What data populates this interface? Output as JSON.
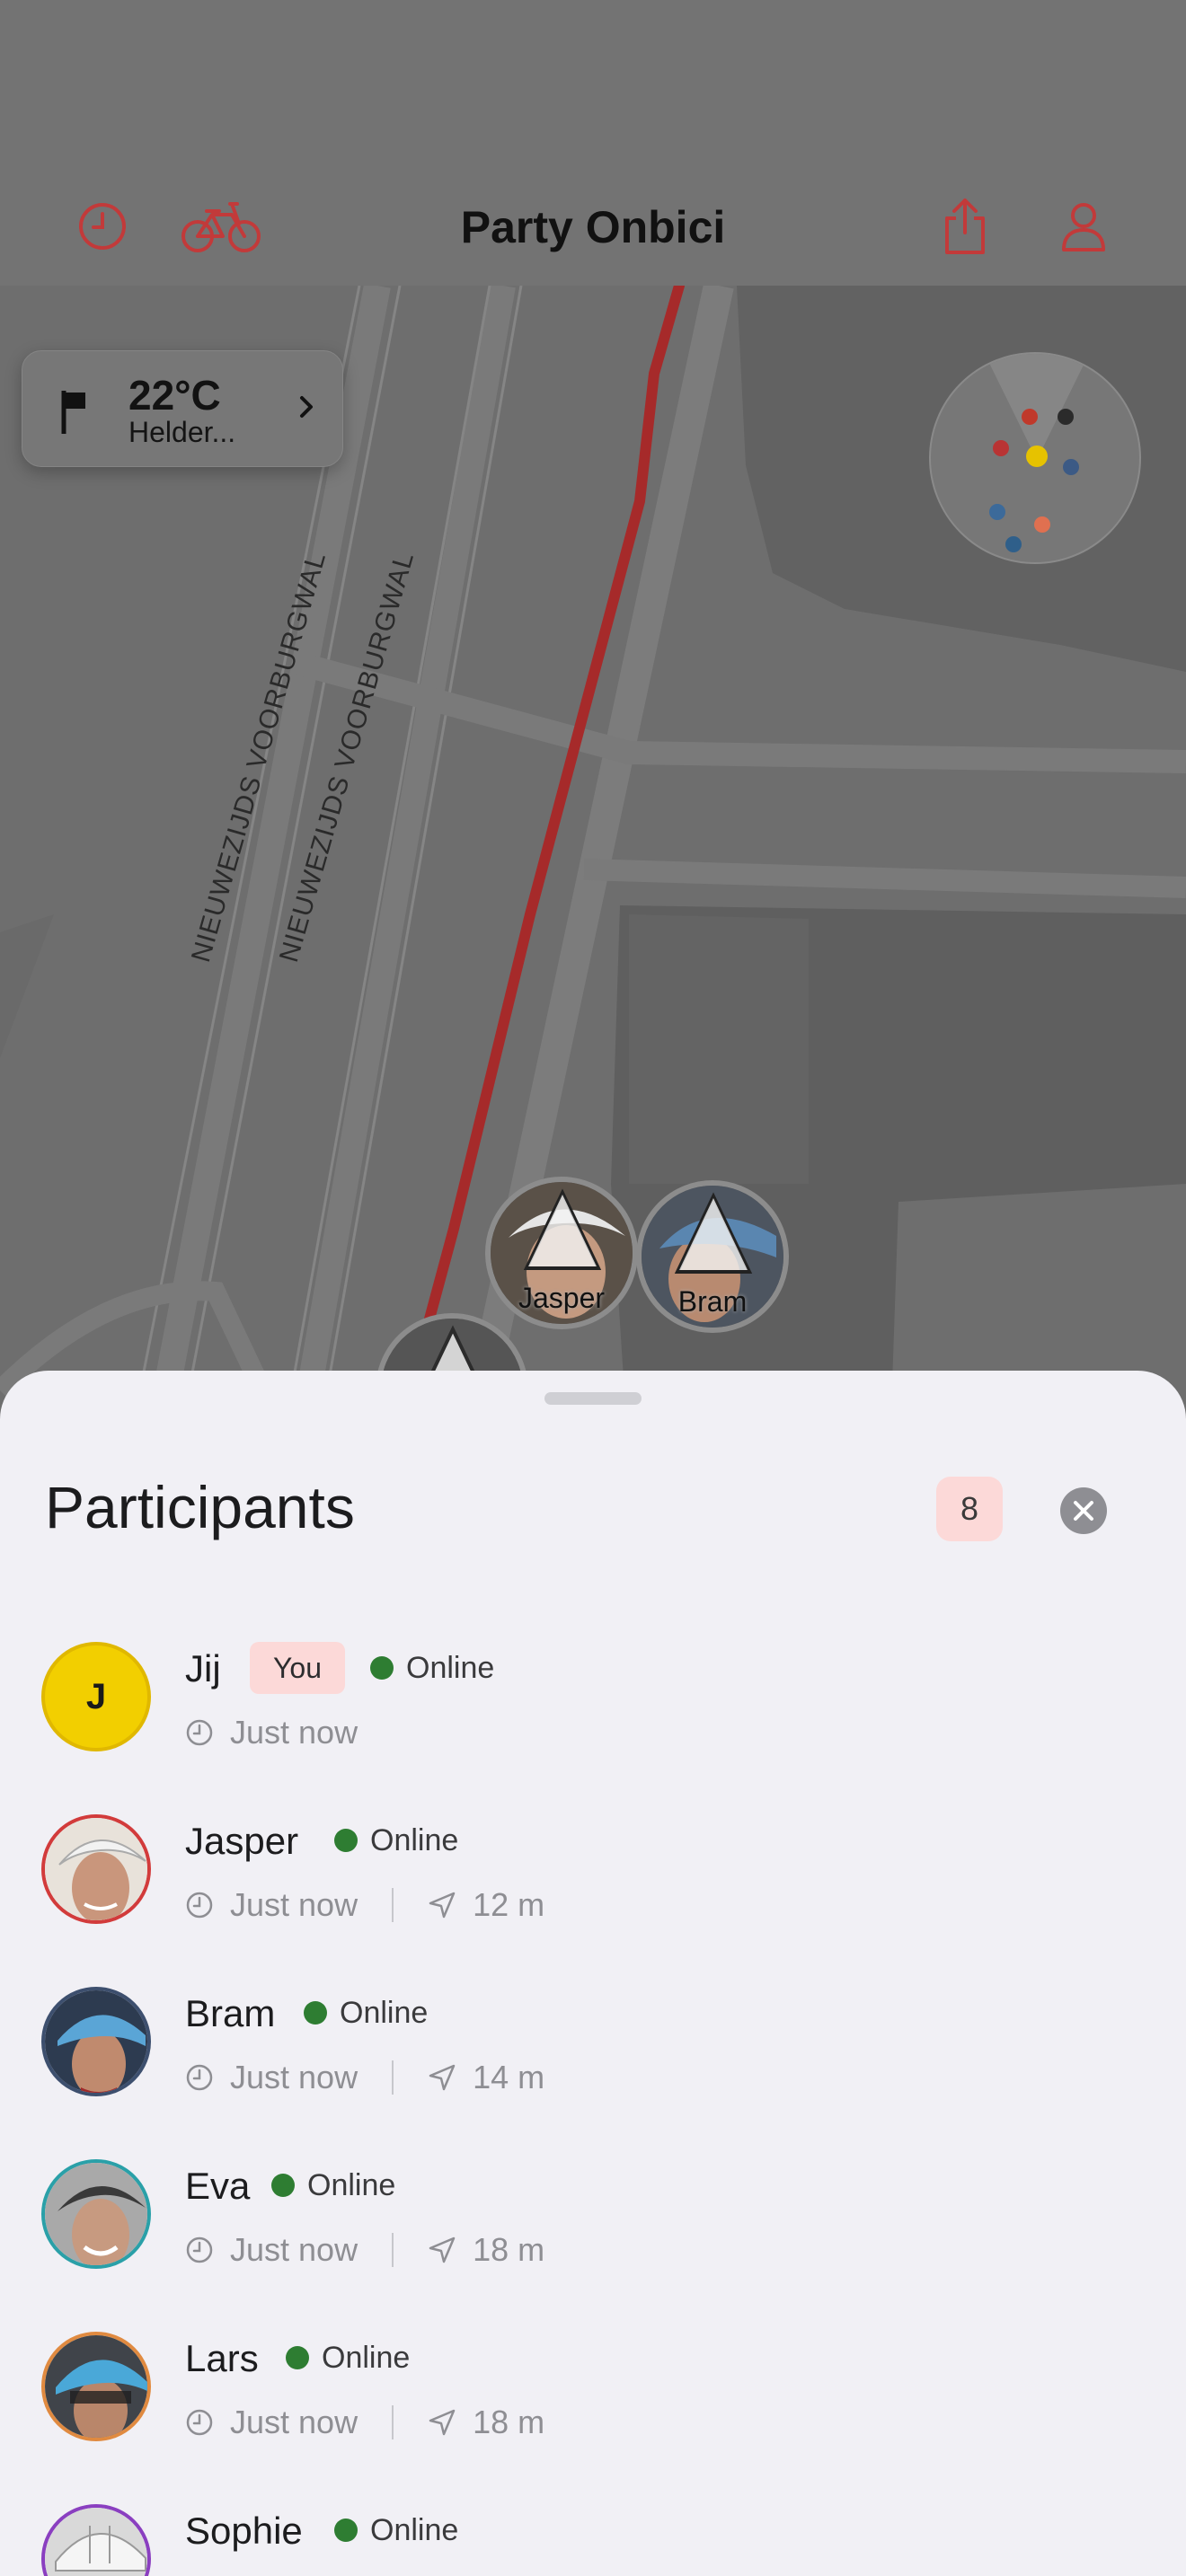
{
  "header": {
    "title": "Party Onbici",
    "icons": [
      "clock-icon",
      "bicycle-icon",
      "share-icon",
      "profile-icon"
    ],
    "accent_color": "#d23b3b"
  },
  "map": {
    "street_labels": [
      "NIEUWEZIJDS VOORBURGWAL",
      "NIEUWEZIJDS VOORBURGWAL"
    ],
    "route_color": "#a62a2a",
    "weather": {
      "temperature": "22°C",
      "description": "Helder..."
    },
    "markers": [
      {
        "label": "Jasper"
      },
      {
        "label": "Bram"
      }
    ],
    "compass_dot_colors": [
      "#c0392b",
      "#2b2b2b",
      "#b93434",
      "#e6c200",
      "#3c5a85",
      "#3c6a9a",
      "#e07050",
      "#2f5f8a"
    ]
  },
  "sheet": {
    "title": "Participants",
    "count": "8",
    "participants": [
      {
        "name": "Jij",
        "initial": "J",
        "you_label": "You",
        "status": "Online",
        "time": "Just now",
        "distance": "",
        "ring": "#e0b800",
        "bg": "#f2cf00"
      },
      {
        "name": "Jasper",
        "status": "Online",
        "time": "Just now",
        "distance": "12 m",
        "ring": "#d23b3b",
        "bg": "#c9b8a8"
      },
      {
        "name": "Bram",
        "status": "Online",
        "time": "Just now",
        "distance": "14 m",
        "ring": "#3d4f6e",
        "bg": "#7f8f9f"
      },
      {
        "name": "Eva",
        "status": "Online",
        "time": "Just now",
        "distance": "18 m",
        "ring": "#2aa0a8",
        "bg": "#9a9a9a"
      },
      {
        "name": "Lars",
        "status": "Online",
        "time": "Just now",
        "distance": "18 m",
        "ring": "#e08a40",
        "bg": "#5a8fb0"
      },
      {
        "name": "Sophie",
        "status": "Online",
        "time": "",
        "distance": "",
        "ring": "#8a3fc0",
        "bg": "#e8e8e8"
      }
    ]
  }
}
